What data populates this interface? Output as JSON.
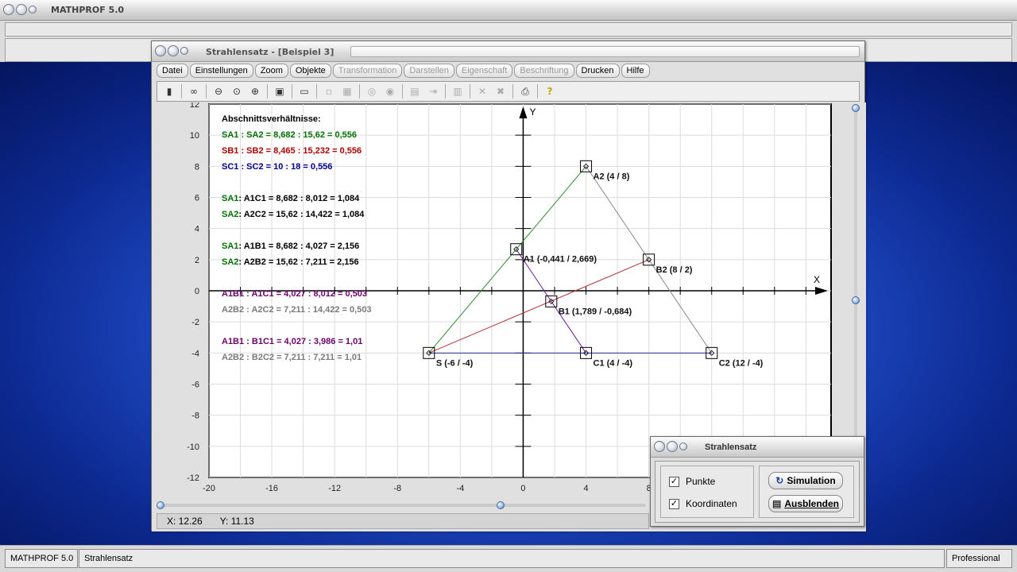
{
  "app": {
    "title": "MATHPROF 5.0"
  },
  "window": {
    "title": "Strahlensatz - [Beispiel 3]"
  },
  "menu": [
    {
      "label": "Datei",
      "enabled": true
    },
    {
      "label": "Einstellungen",
      "enabled": true
    },
    {
      "label": "Zoom",
      "enabled": true
    },
    {
      "label": "Objekte",
      "enabled": true
    },
    {
      "label": "Transformation",
      "enabled": false
    },
    {
      "label": "Darstellen",
      "enabled": false
    },
    {
      "label": "Eigenschaft",
      "enabled": false
    },
    {
      "label": "Beschriftung",
      "enabled": false
    },
    {
      "label": "Drucken",
      "enabled": true
    },
    {
      "label": "Hilfe",
      "enabled": true
    }
  ],
  "toolbar": [
    "calculator-icon",
    "glasses-icon",
    "zoom-out-icon",
    "zoom-icon",
    "zoom-in-icon",
    "settings-icon",
    "window-icon",
    "grid-small-icon",
    "grid-box-icon",
    "zoom-box-icon",
    "zoom-fit-icon",
    "table-icon",
    "export-icon",
    "copy-icon",
    "delete-icon",
    "delete-all-icon",
    "print-icon",
    "help-icon"
  ],
  "text": {
    "heading": "Abschnittsverhältnisse:",
    "lines": [
      {
        "t": "SA1 : SA2 = 8,682 : 15,62 = 0,556",
        "c": "#007000"
      },
      {
        "t": "SB1 : SB2 = 8,465 : 15,232 = 0,556",
        "c": "#b00000"
      },
      {
        "t": "SC1 : SC2 = 10 : 18 = 0,556",
        "c": "#00008b"
      },
      {
        "t": "SA1 : A1C1 = 8,682 : 8,012 = 1,084",
        "p1": "SA1",
        "p2": "A1C1 = 8,682 : 8,012 = 1,084",
        "c1": "#007000",
        "c2": "#000000"
      },
      {
        "t": "SA2 : A2C2 = 15,62 : 14,422 = 1,084",
        "p1": "SA2",
        "p2": "A2C2 = 15,62 : 14,422 = 1,084",
        "c1": "#007000",
        "c2": "#000000"
      },
      {
        "t": "SA1 : A1B1 = 8,682 : 4,027 = 2,156",
        "p1": "SA1",
        "p2": "A1B1 = 8,682 : 4,027 = 2,156",
        "c1": "#007000",
        "c2": "#000000"
      },
      {
        "t": "SA2 : A2B2 = 15,62 : 7,211 = 2,156",
        "p1": "SA2",
        "p2": "A2B2 = 15,62 : 7,211 = 2,156",
        "c1": "#007000",
        "c2": "#000000"
      },
      {
        "t": "A1B1 : A1C1 = 4,027 : 8,012 = 0,503",
        "c": "#6a006a"
      },
      {
        "t": "A2B2 : A2C2 = 7,211 : 14,422 = 0,503",
        "c": "#7a7a7a"
      },
      {
        "t": "A1B1 : B1C1 = 4,027 : 3,986 = 1,01",
        "c": "#6a006a"
      },
      {
        "t": "A2B2 : B2C2 = 7,211 : 7,211 = 1,01",
        "c": "#7a7a7a"
      }
    ]
  },
  "chart_data": {
    "type": "scatter",
    "xlim": [
      -20,
      20
    ],
    "ylim": [
      -12,
      12
    ],
    "xticks": [
      -20,
      -16,
      -12,
      -8,
      -4,
      0,
      4,
      8
    ],
    "yticks": [
      12,
      10,
      8,
      6,
      4,
      2,
      0,
      -2,
      -4,
      -6,
      -8,
      -10,
      -12
    ],
    "xlabel": "X",
    "ylabel": "Y",
    "grid": true,
    "points": [
      {
        "name": "S",
        "x": -6,
        "y": -4,
        "label": "S (-6 / -4)"
      },
      {
        "name": "A1",
        "x": -0.441,
        "y": 2.669,
        "label": "A1 (-0,441 / 2,669)"
      },
      {
        "name": "A2",
        "x": 4,
        "y": 8,
        "label": "A2 (4 / 8)"
      },
      {
        "name": "B1",
        "x": 1.789,
        "y": -0.684,
        "label": "B1 (1,789 / -0,684)"
      },
      {
        "name": "B2",
        "x": 8,
        "y": 2,
        "label": "B2 (8 / 2)"
      },
      {
        "name": "C1",
        "x": 4,
        "y": -4,
        "label": "C1 (4 / -4)"
      },
      {
        "name": "C2",
        "x": 12,
        "y": -4,
        "label": "C2 (12 / -4)"
      }
    ],
    "segments": [
      {
        "from": "S",
        "to": "A2",
        "color": "#2e8b2e"
      },
      {
        "from": "S",
        "to": "B2",
        "color": "#b03030"
      },
      {
        "from": "S",
        "to": "C2",
        "color": "#1f2f8f"
      },
      {
        "from": "A1",
        "to": "B1",
        "color": "#6a1a9a"
      },
      {
        "from": "B1",
        "to": "C1",
        "color": "#6a1a9a"
      },
      {
        "from": "A2",
        "to": "B2",
        "color": "#8a8a8a"
      },
      {
        "from": "B2",
        "to": "C2",
        "color": "#8a8a8a"
      }
    ]
  },
  "coords": {
    "x": "X: 12.26",
    "y": "Y: 11.13"
  },
  "dialog": {
    "title": "Strahlensatz",
    "punkte": "Punkte",
    "koordinaten": "Koordinaten",
    "simulation": "Simulation",
    "ausblenden": "Ausblenden"
  },
  "status": {
    "app": "MATHPROF 5.0",
    "module": "Strahlensatz",
    "edition": "Professional"
  }
}
